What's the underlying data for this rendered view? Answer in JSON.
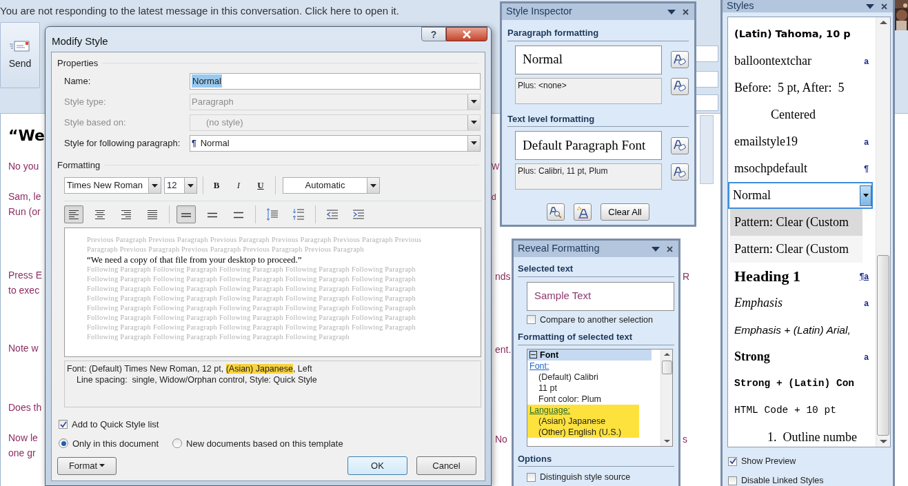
{
  "info_bar": {
    "text": "You are not responding to the latest message in this conversation. Click here to open it."
  },
  "compose": {
    "send_button": "Send",
    "body_left": [
      "“We",
      "No you",
      "Sam, le",
      "Run (or",
      "Press E",
      "to exec",
      "Note w",
      "Does th",
      "Now le",
      "one gr"
    ],
    "body_right": [
      "W",
      "d",
      "nds",
      "ent.",
      "No",
      "R",
      "s"
    ]
  },
  "modify_style": {
    "title": "Modify Style",
    "help_button": "?",
    "properties_label": "Properties",
    "fields": [
      {
        "kind": "text",
        "label": "Name:",
        "value": "Normal",
        "disabled": false,
        "highlighted": true
      },
      {
        "kind": "dropdown",
        "label": "Style type:",
        "value": "Paragraph",
        "disabled": true,
        "highlighted": false
      },
      {
        "kind": "dropdown",
        "label": "Style based on:",
        "value": "(no style)",
        "disabled": true,
        "highlighted": false
      },
      {
        "kind": "dropdown",
        "label": "Style for following paragraph:",
        "value": "Normal",
        "glyph": "¶",
        "disabled": false,
        "highlighted": false
      }
    ],
    "formatting_label": "Formatting",
    "font": "Times New Roman",
    "size": "12",
    "style_buttons": [
      "B",
      "I",
      "U"
    ],
    "font_color": "Automatic",
    "alignment": [
      {
        "kind": "left",
        "selected": true
      },
      {
        "kind": "center",
        "selected": false
      },
      {
        "kind": "right",
        "selected": false
      },
      {
        "kind": "justify",
        "selected": false
      }
    ],
    "line_spacing": [
      {
        "kind": "single",
        "selected": true
      },
      {
        "kind": "onehalf",
        "selected": false
      },
      {
        "kind": "double",
        "selected": false
      }
    ],
    "preview": {
      "previous_lines": [
        "Previous Paragraph Previous Paragraph Previous Paragraph Previous Paragraph Previous Paragraph Previous",
        "Paragraph Previous Paragraph Previous Paragraph Previous Paragraph Previous Paragraph"
      ],
      "sample": "“We need a copy of that file from your desktop to proceed.”",
      "following_lines": [
        "Following Paragraph Following Paragraph Following Paragraph Following Paragraph Following Paragraph",
        "Following Paragraph Following Paragraph Following Paragraph Following Paragraph Following Paragraph",
        "Following Paragraph Following Paragraph Following Paragraph Following Paragraph Following Paragraph",
        "Following Paragraph Following Paragraph Following Paragraph Following Paragraph Following Paragraph",
        "Following Paragraph Following Paragraph Following Paragraph Following Paragraph Following Paragraph",
        "Following Paragraph Following Paragraph Following Paragraph Following Paragraph Following Paragraph",
        "Following Paragraph Following Paragraph Following Paragraph Following Paragraph Following Paragraph",
        "Following Paragraph Following Paragraph Following Paragraph Following Paragraph"
      ]
    },
    "description": [
      [
        {
          "text": "Font: (Default) Times New Roman, 12 pt, ",
          "highlighted": false
        },
        {
          "text": "(Asian) Japanese",
          "highlighted": true
        },
        {
          "text": ", Left",
          "highlighted": false
        }
      ],
      [
        {
          "text": "Line spacing:  single, Widow/Orphan control, Style: Quick Style",
          "highlighted": false
        }
      ]
    ],
    "quick_style": {
      "label": "Add to Quick Style list",
      "checked": true
    },
    "scope": [
      {
        "label": "Only in this document",
        "selected": true
      },
      {
        "label": "New documents based on this template",
        "selected": false
      }
    ],
    "format_button": "Format",
    "ok_button": "OK",
    "cancel_button": "Cancel"
  },
  "style_inspector": {
    "title": "Style Inspector",
    "paragraph_heading": "Paragraph formatting",
    "paragraph_style": "Normal",
    "paragraph_plus": "Plus: <none>",
    "text_heading": "Text level formatting",
    "text_style": "Default Paragraph Font",
    "text_plus": "Plus: Calibri, 11 pt, Plum",
    "clear_button": "Clear All"
  },
  "reveal_formatting": {
    "title": "Reveal Formatting",
    "selected_heading": "Selected text",
    "sample": "Sample Text",
    "compare": {
      "label": "Compare to another selection",
      "checked": false
    },
    "formatting_heading": "Formatting of selected text",
    "tree": {
      "label": "Font",
      "expanded": true,
      "children": [
        {
          "kind": "link",
          "text": "Font:",
          "highlighted": false
        },
        {
          "kind": "value",
          "text": "(Default) Calibri",
          "highlighted": false
        },
        {
          "kind": "value",
          "text": "11 pt",
          "highlighted": false
        },
        {
          "kind": "value",
          "text": "Font color: Plum",
          "highlighted": false
        },
        {
          "kind": "link",
          "text": "Language:",
          "highlighted": true
        },
        {
          "kind": "value",
          "text": "(Asian) Japanese",
          "highlighted": true
        },
        {
          "kind": "value",
          "text": "(Other) English (U.S.)",
          "highlighted": true
        }
      ]
    },
    "options_heading": "Options",
    "distinguish": {
      "label": "Distinguish style source",
      "checked": false
    }
  },
  "styles": {
    "title": "Styles",
    "items": [
      {
        "kind": "tahoma",
        "text": "(Latin) Tahoma, 10 p",
        "selected": false,
        "hovered": false
      },
      {
        "kind": "serif",
        "text": "balloontextchar",
        "marker": "a",
        "selected": false,
        "hovered": false
      },
      {
        "kind": "serif",
        "text": "Before:  5 pt, After:  5",
        "selected": false,
        "hovered": false
      },
      {
        "kind": "centered",
        "text": "Centered",
        "selected": false,
        "hovered": false
      },
      {
        "kind": "serif",
        "text": "emailstyle19",
        "marker": "a",
        "selected": false,
        "hovered": false
      },
      {
        "kind": "serif",
        "text": "msochpdefault",
        "marker": "¶",
        "selected": false,
        "hovered": false
      },
      {
        "kind": "serif",
        "text": "Normal",
        "selected": true,
        "hovered": false
      },
      {
        "kind": "pattern",
        "text": "Pattern: Clear (Custom",
        "selected": false,
        "hovered": true
      },
      {
        "kind": "pattern",
        "text": "Pattern: Clear (Custom",
        "selected": false,
        "hovered": false
      },
      {
        "kind": "heading",
        "text": "Heading 1",
        "marker": "¶a",
        "selected": false,
        "hovered": false
      },
      {
        "kind": "emphasis",
        "text": "Emphasis",
        "marker": "a",
        "selected": false,
        "hovered": false
      },
      {
        "kind": "sans_emphasis",
        "text": "Emphasis + (Latin) Arial,",
        "selected": false,
        "hovered": false
      },
      {
        "kind": "strong",
        "text": "Strong",
        "marker": "a",
        "selected": false,
        "hovered": false
      },
      {
        "kind": "mono_strong",
        "text": "Strong + (Latin) Con",
        "selected": false,
        "hovered": false
      },
      {
        "kind": "mono",
        "text": "HTML Code + 10 pt",
        "selected": false,
        "hovered": false
      },
      {
        "kind": "outline",
        "text": "1.  Outline numbe",
        "selected": false,
        "hovered": false
      }
    ],
    "show_preview": {
      "label": "Show Preview",
      "checked": true
    },
    "disable_linked": {
      "label": "Disable Linked Styles",
      "checked": false
    }
  }
}
